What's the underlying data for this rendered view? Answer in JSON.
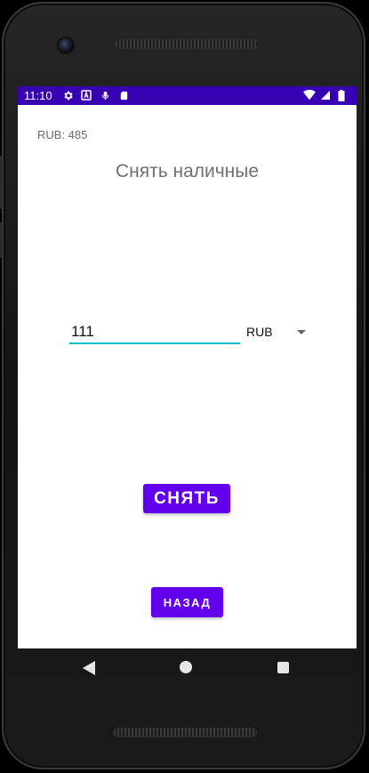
{
  "status_bar": {
    "time": "11:10",
    "left_icons": [
      "gear-icon",
      "text-a-icon",
      "microphone-icon",
      "sd-card-icon"
    ],
    "right_icons": [
      "wifi-icon",
      "signal-icon",
      "battery-icon"
    ],
    "color": "#3700b3"
  },
  "screen": {
    "balance_text": "RUB: 485",
    "title": "Снять наличные",
    "amount_input": {
      "value": "111"
    },
    "currency_select": {
      "selected": "RUB"
    },
    "withdraw_button_label": "СНЯТЬ",
    "back_button_label": "НАЗАД"
  },
  "colors": {
    "accent": "#6200ee",
    "status_bar": "#3700b3",
    "input_underline": "#00bcd4"
  },
  "navigation_bar": {
    "buttons": [
      "back-icon",
      "home-icon",
      "recents-icon"
    ]
  }
}
